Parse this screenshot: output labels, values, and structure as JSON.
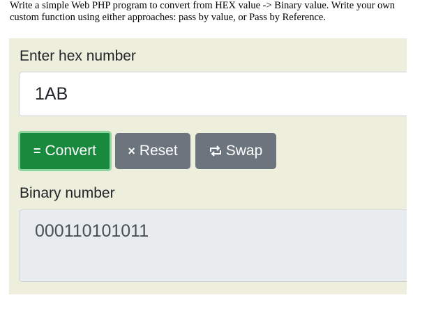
{
  "instructions": {
    "line1": "Write a simple Web PHP program to convert from HEX value -> Binary value.  Write your own",
    "line2": "custom function using either approaches: pass by value, or Pass by Reference."
  },
  "form": {
    "hex_label": "Enter hex number",
    "hex_value": "1AB",
    "binary_label": "Binary number",
    "binary_value": "000110101011"
  },
  "buttons": {
    "convert": {
      "icon": "=",
      "label": "Convert",
      "icon_name": "equals-icon"
    },
    "reset": {
      "icon": "×",
      "label": "Reset",
      "icon_name": "close-icon"
    },
    "swap": {
      "icon": "⇆",
      "label": "Swap",
      "icon_name": "swap-icon"
    }
  },
  "colors": {
    "panel_bg": "#eeeedd",
    "convert_bg": "#198a3d",
    "secondary_bg": "#6c757d"
  }
}
